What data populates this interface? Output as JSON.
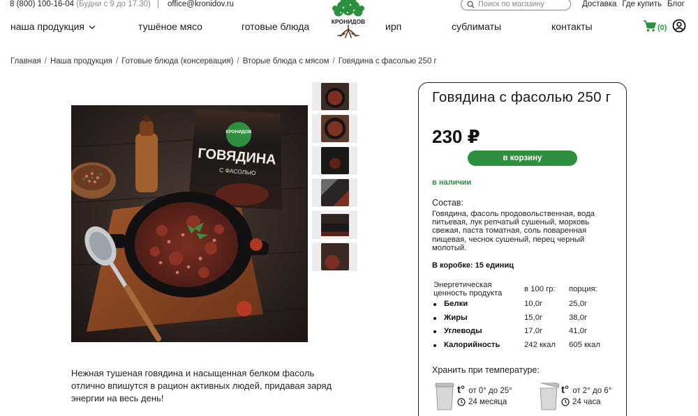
{
  "topbar": {
    "phone": "8 (800) 100-16-04",
    "hours": "(Будни с 9 до 17.30)",
    "email": "office@kronidov.ru",
    "search_placeholder": "Поиск по магазину",
    "links": [
      "Доставка",
      "Где купить",
      "Блог"
    ]
  },
  "logo": {
    "text": "КРОНИДОВ"
  },
  "nav": {
    "items": [
      "наша продукция",
      "тушёное мясо",
      "готовые блюда",
      "ирп",
      "сублиматы",
      "контакты"
    ],
    "cart_count": "(0)"
  },
  "breadcrumb": [
    "Главная",
    "Наша продукция",
    "Готовые блюда (консервация)",
    "Вторые блюда с мясом",
    "Говядина с фасолью 250 г"
  ],
  "product": {
    "title": "Говядина с фасолью 250 г",
    "price": "230 ₽",
    "buy_label": "в корзину",
    "stock": "в наличии",
    "composition_label": "Состав:",
    "composition": "Говядина, фасоль продовольственная, вода питьевая, лук репчатый сушеный, морковь свежая, паста томатная, соль поваренная пищевая, чеснок сушеный, перец черный молотый.",
    "box": "В коробке: 15 единиц",
    "description": "Нежная тушеная говядина и насыщенная белком фасоль отлично впишутся в рацион активных людей, придавая заряд энергии на весь день!",
    "package_label": {
      "brand": "КРОНИДОВ",
      "name": "ГОВЯДИНА",
      "sub": "С ФАСОЛЬЮ"
    }
  },
  "nutrition": {
    "header": [
      "Энергетическая ценность продукта",
      "в 100 гр:",
      "порция:"
    ],
    "rows": [
      {
        "name": "Белки",
        "per100": "10,0г",
        "portion": "25,0г"
      },
      {
        "name": "Жиры",
        "per100": "15,0г",
        "portion": "38,0г"
      },
      {
        "name": "Углеводы",
        "per100": "17,0г",
        "portion": "41,0г"
      },
      {
        "name": "Калорийность",
        "per100": "242 ккал",
        "portion": "605 ккал"
      }
    ]
  },
  "storage": {
    "label": "Хранить при температуре:",
    "closed": {
      "temp": "от 0° до 25°",
      "duration": "24 месяца"
    },
    "opened": {
      "temp": "от 2° до 6°",
      "duration": "24 часа"
    }
  },
  "colors": {
    "accent": "#2e8f3e",
    "border": "#222222"
  }
}
